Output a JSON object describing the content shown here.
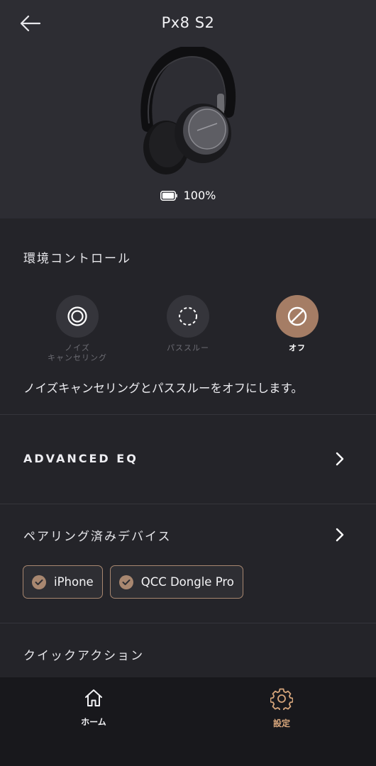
{
  "header": {
    "title": "Px8 S2",
    "back_icon": "arrow-left-icon",
    "battery_percent": "100%",
    "battery_level": 1.0
  },
  "ambient": {
    "title": "環境コントロール",
    "modes": [
      {
        "label_line1": "ノイズ",
        "label_line2": "キャンセリング",
        "icon": "noise-cancelling-icon",
        "active": false
      },
      {
        "label_line1": "パススルー",
        "label_line2": "",
        "icon": "pass-through-icon",
        "active": false
      },
      {
        "label_line1": "オフ",
        "label_line2": "",
        "icon": "off-icon",
        "active": true
      }
    ],
    "description": "ノイズキャンセリングとパススルーをオフにします。"
  },
  "advanced_eq": {
    "title": "ADVANCED EQ"
  },
  "paired": {
    "title": "ペアリング済みデバイス",
    "devices": [
      {
        "name": "iPhone"
      },
      {
        "name": "QCC Dongle Pro"
      }
    ]
  },
  "quick_actions": {
    "title": "クイックアクション"
  },
  "nav": {
    "items": [
      {
        "label": "ホーム",
        "icon": "home-icon",
        "active": false
      },
      {
        "label": "設定",
        "icon": "gear-icon",
        "active": true
      }
    ]
  },
  "colors": {
    "accent": "#a57d65",
    "nav_active": "#d6a57b",
    "header_bg": "#2d2d33",
    "content_bg": "#242429"
  }
}
